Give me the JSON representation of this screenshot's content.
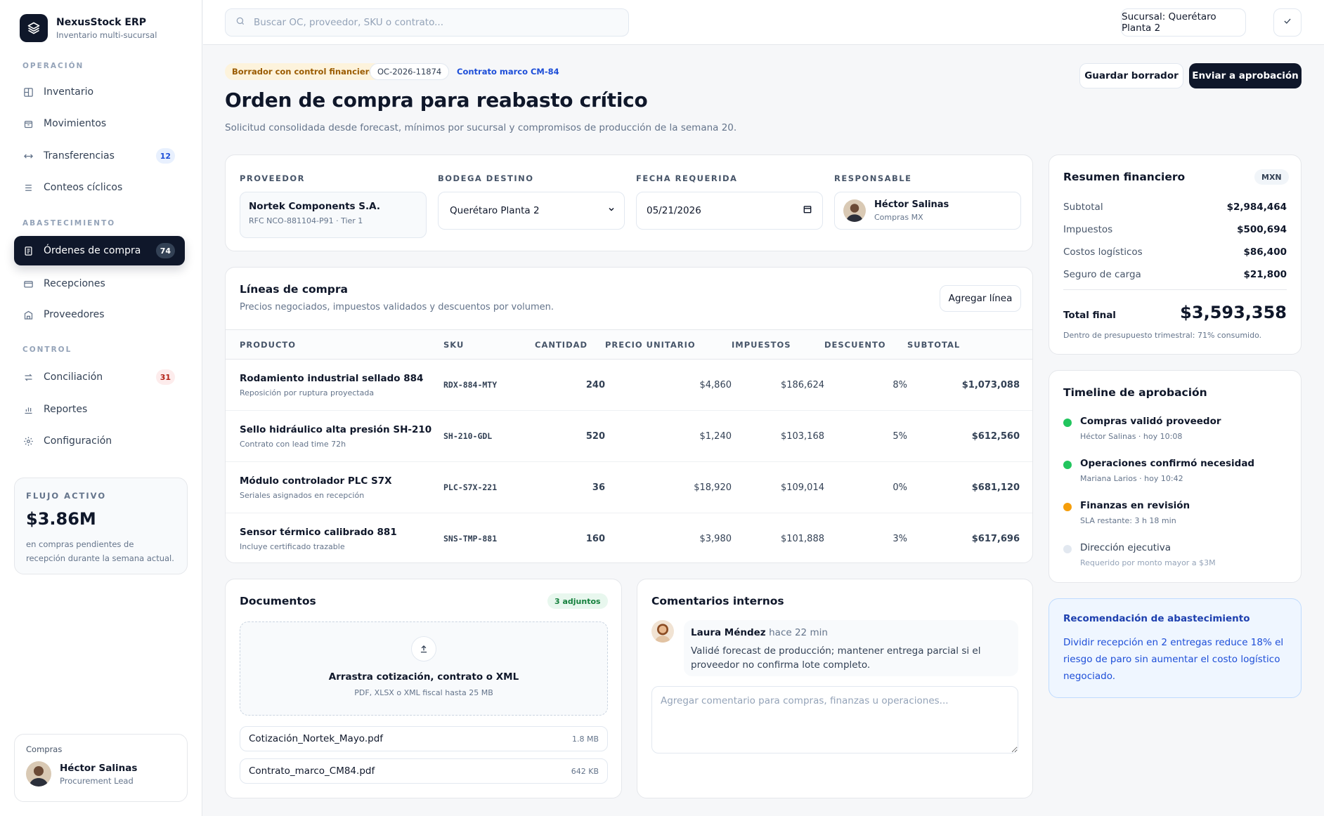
{
  "brand": {
    "name": "NexusStock ERP",
    "subtitle": "Inventario multi-sucursal"
  },
  "sidebar": {
    "sections": {
      "operacion": "OPERACIÓN",
      "abastecimiento": "ABASTECIMIENTO",
      "control": "CONTROL"
    },
    "items": [
      {
        "label": "Inventario",
        "icon": "grid-icon"
      },
      {
        "label": "Movimientos",
        "icon": "box-icon"
      },
      {
        "label": "Transferencias",
        "icon": "arrows-horizontal-icon",
        "badge": "12"
      },
      {
        "label": "Conteos cíclicos",
        "icon": "list-icon"
      },
      {
        "label": "Órdenes de compra",
        "icon": "document-icon",
        "badge": "74",
        "active": true
      },
      {
        "label": "Recepciones",
        "icon": "inbox-icon"
      },
      {
        "label": "Proveedores",
        "icon": "building-icon"
      },
      {
        "label": "Conciliación",
        "icon": "swap-icon",
        "badge": "31"
      },
      {
        "label": "Reportes",
        "icon": "bar-chart-icon"
      },
      {
        "label": "Configuración",
        "icon": "gear-icon"
      }
    ],
    "flow": {
      "label": "FLUJO ACTIVO",
      "value": "$3.86M",
      "desc": "en compras pendientes de recepción durante la semana actual."
    },
    "user": {
      "role": "Compras",
      "name": "Héctor Salinas",
      "title": "Procurement Lead"
    }
  },
  "topbar": {
    "search_placeholder": "Buscar OC, proveedor, SKU o contrato...",
    "branch": "Sucursal: Querétaro Planta 2"
  },
  "header": {
    "tags": {
      "status": "Borrador con control financiero",
      "po": "OC-2026-11874",
      "contract": "Contrato marco CM-84"
    },
    "title": "Orden de compra para reabasto crítico",
    "subtitle": "Solicitud consolidada desde forecast, mínimos por sucursal y compromisos de producción de la semana 20.",
    "save_label": "Guardar borrador",
    "send_label": "Enviar a aprobación"
  },
  "form": {
    "supplier_label": "PROVEEDOR",
    "supplier_name": "Nortek Components S.A.",
    "supplier_rfc": "RFC NCO-881104-P91 · Tier 1",
    "warehouse_label": "BODEGA DESTINO",
    "warehouse_value": "Querétaro Planta 2",
    "date_label": "FECHA REQUERIDA",
    "date_value": "05/21/2026",
    "owner_label": "RESPONSABLE",
    "owner_name": "Héctor Salinas",
    "owner_team": "Compras MX"
  },
  "lines": {
    "title": "Líneas de compra",
    "subtitle": "Precios negociados, impuestos validados y descuentos por volumen.",
    "add_label": "Agregar línea",
    "columns": [
      "PRODUCTO",
      "SKU",
      "CANTIDAD",
      "PRECIO UNITARIO",
      "IMPUESTOS",
      "DESCUENTO",
      "SUBTOTAL"
    ],
    "rows": [
      {
        "name": "Rodamiento industrial sellado 884",
        "note": "Reposición por ruptura proyectada",
        "sku": "RDX-884-MTY",
        "qty": "240",
        "price": "$4,860",
        "tax": "$186,624",
        "disc": "8%",
        "sub": "$1,073,088"
      },
      {
        "name": "Sello hidráulico alta presión SH-210",
        "note": "Contrato con lead time 72h",
        "sku": "SH-210-GDL",
        "qty": "520",
        "price": "$1,240",
        "tax": "$103,168",
        "disc": "5%",
        "sub": "$612,560"
      },
      {
        "name": "Módulo controlador PLC S7X",
        "note": "Seriales asignados en recepción",
        "sku": "PLC-S7X-221",
        "qty": "36",
        "price": "$18,920",
        "tax": "$109,014",
        "disc": "0%",
        "sub": "$681,120"
      },
      {
        "name": "Sensor térmico calibrado 881",
        "note": "Incluye certificado trazable",
        "sku": "SNS-TMP-881",
        "qty": "160",
        "price": "$3,980",
        "tax": "$101,888",
        "disc": "3%",
        "sub": "$617,696"
      }
    ]
  },
  "documents": {
    "title": "Documentos",
    "count": "3 adjuntos",
    "drop_title": "Arrastra cotización, contrato o XML",
    "drop_sub": "PDF, XLSX o XML fiscal hasta 25 MB",
    "files": [
      {
        "name": "Cotización_Nortek_Mayo.pdf",
        "size": "1.8 MB"
      },
      {
        "name": "Contrato_marco_CM84.pdf",
        "size": "642 KB"
      }
    ]
  },
  "comments": {
    "title": "Comentarios internos",
    "author": "Laura Méndez",
    "time": "hace 22 min",
    "text": "Validé forecast de producción; mantener entrega parcial si el proveedor no confirma lote completo.",
    "placeholder": "Agregar comentario para compras, finanzas u operaciones..."
  },
  "summary": {
    "title": "Resumen financiero",
    "currency": "MXN",
    "rows": [
      {
        "k": "Subtotal",
        "v": "$2,984,464"
      },
      {
        "k": "Impuestos",
        "v": "$500,694"
      },
      {
        "k": "Costos logísticos",
        "v": "$86,400"
      },
      {
        "k": "Seguro de carga",
        "v": "$21,800"
      }
    ],
    "total_label": "Total final",
    "total_value": "$3,593,358",
    "budget_note": "Dentro de presupuesto trimestral: 71% consumido."
  },
  "timeline": {
    "title": "Timeline de aprobación",
    "items": [
      {
        "title": "Compras validó proveedor",
        "sub": "Héctor Salinas · hoy 10:08",
        "color": "#22c55e"
      },
      {
        "title": "Operaciones confirmó necesidad",
        "sub": "Mariana Larios · hoy 10:42",
        "color": "#22c55e"
      },
      {
        "title": "Finanzas en revisión",
        "sub": "SLA restante: 3 h 18 min",
        "color": "#f59e0b"
      },
      {
        "title": "Dirección ejecutiva",
        "sub": "Requerido por monto mayor a $3M",
        "color": "#e2e8f0"
      }
    ]
  },
  "recommendation": {
    "title": "Recomendación de abastecimiento",
    "text": "Dividir recepción en 2 entregas reduce 18% el riesgo de paro sin aumentar el costo logístico negociado."
  }
}
